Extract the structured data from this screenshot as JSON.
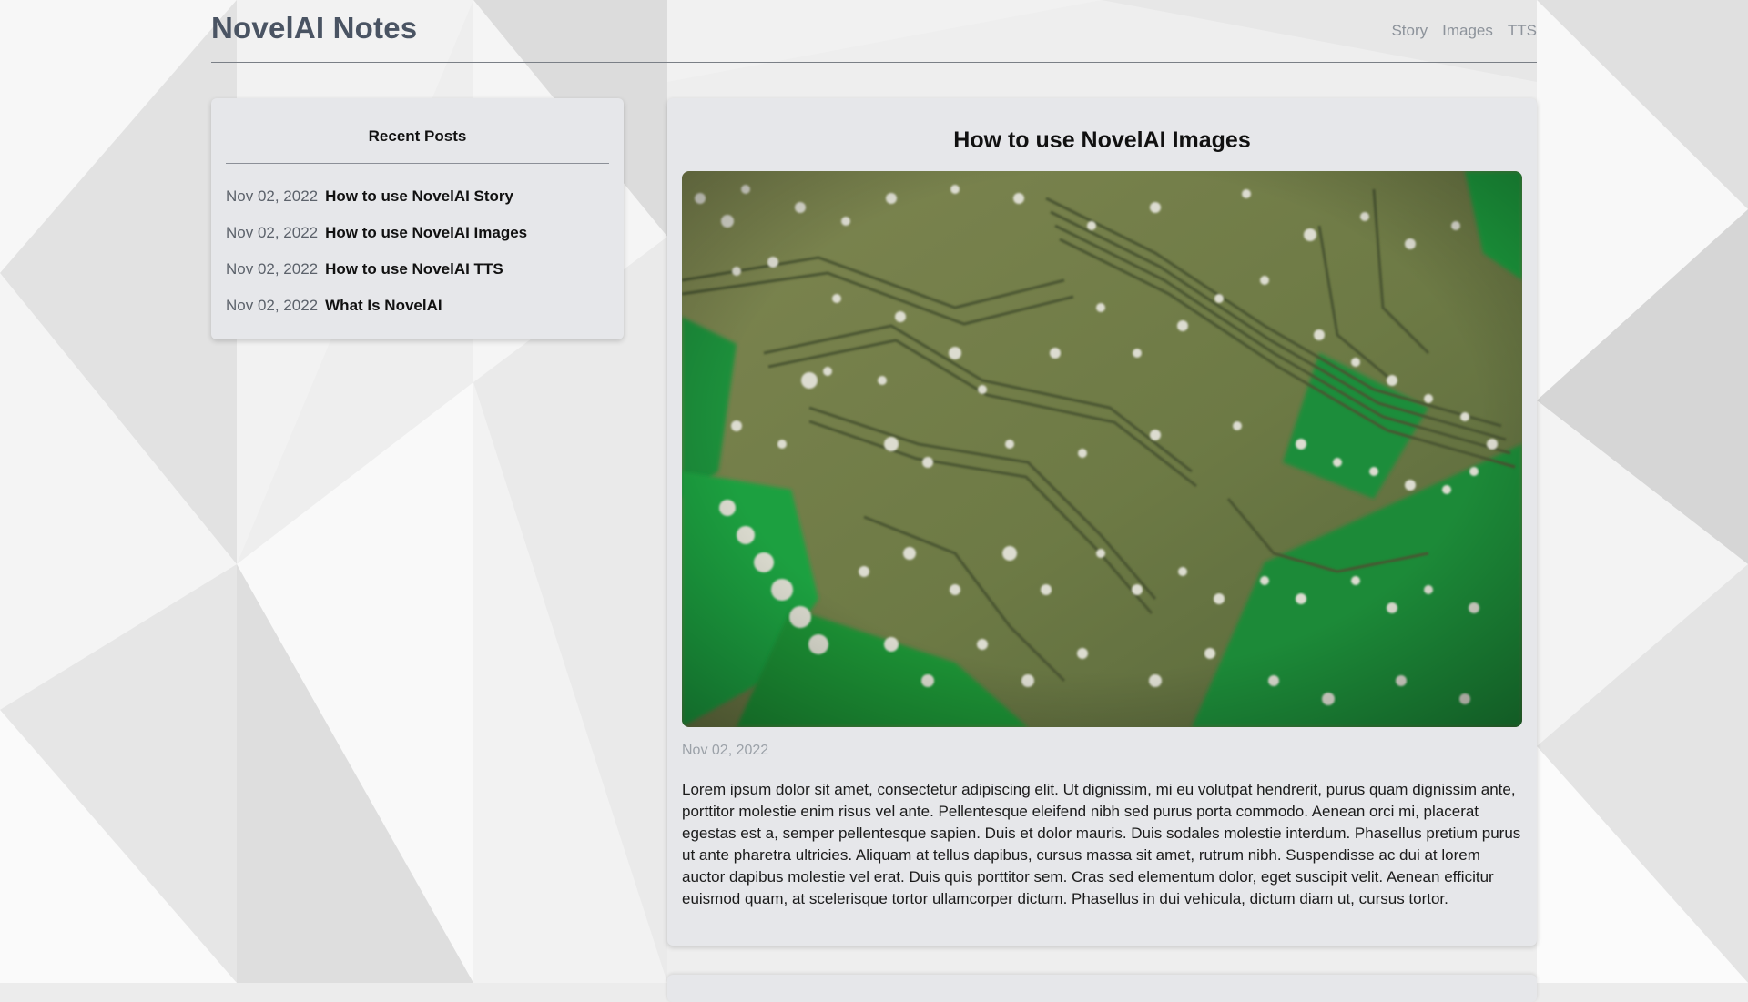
{
  "header": {
    "site_title": "NovelAI Notes",
    "nav": [
      {
        "label": "Story"
      },
      {
        "label": "Images"
      },
      {
        "label": "TTS"
      }
    ]
  },
  "sidebar": {
    "title": "Recent Posts",
    "posts": [
      {
        "date": "Nov 02, 2022",
        "title": "How to use NovelAI Story"
      },
      {
        "date": "Nov 02, 2022",
        "title": "How to use NovelAI Images"
      },
      {
        "date": "Nov 02, 2022",
        "title": "How to use NovelAI TTS"
      },
      {
        "date": "Nov 02, 2022",
        "title": "What Is NovelAI"
      }
    ]
  },
  "article": {
    "title": "How to use NovelAI Images",
    "image_subject": "green-circuit-board-photo",
    "date": "Nov 02, 2022",
    "body": "Lorem ipsum dolor sit amet, consectetur adipiscing elit. Ut dignissim, mi eu volutpat hendrerit, purus quam dignissim ante, porttitor molestie enim risus vel ante. Pellentesque eleifend nibh sed purus porta commodo. Aenean orci mi, placerat egestas est a, semper pellentesque sapien. Duis et dolor mauris. Duis sodales molestie interdum. Phasellus pretium purus ut ante pharetra ultricies. Aliquam at tellus dapibus, cursus massa sit amet, rutrum nibh. Suspendisse ac dui at lorem auctor dapibus molestie vel erat. Duis quis porttitor sem. Cras sed elementum dolor, eget suscipit velit. Aenean efficitur euismod quam, at scelerisque tortor ullamcorper dictum. Phasellus in dui vehicula, dictum diam ut, cursus tortor."
  },
  "colors": {
    "site_title": "#4a5463",
    "nav_link": "#8d939b",
    "card_background": "#e6e7ea",
    "board_olive": "#6f7a45",
    "board_green": "#1f9a3f"
  }
}
